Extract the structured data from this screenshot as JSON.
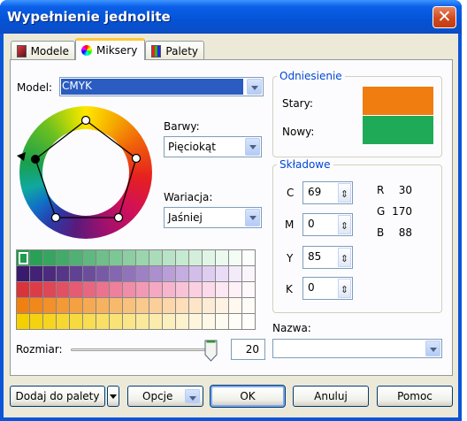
{
  "dialog": {
    "title": "Wypełnienie jednolite",
    "close_glyph": "✕"
  },
  "tabs": [
    {
      "label": "Modele",
      "icon": "models-icon"
    },
    {
      "label": "Miksery",
      "icon": "mixers-icon"
    },
    {
      "label": "Palety",
      "icon": "palettes-icon"
    }
  ],
  "model": {
    "label": "Model:",
    "value": "CMYK"
  },
  "harmony": {
    "label": "Barwy:",
    "value": "Pięciokąt"
  },
  "variation": {
    "label": "Wariacja:",
    "value": "Jaśniej"
  },
  "reference": {
    "title": "Odniesienie",
    "old_label": "Stary:",
    "new_label": "Nowy:",
    "old_color": "#f07d0f",
    "new_color": "#1faa58"
  },
  "components": {
    "title": "Składowe",
    "cmyk": [
      {
        "label": "C",
        "value": "69"
      },
      {
        "label": "M",
        "value": "0"
      },
      {
        "label": "Y",
        "value": "85"
      },
      {
        "label": "K",
        "value": "0"
      }
    ],
    "rgb": [
      {
        "label": "R",
        "value": "30"
      },
      {
        "label": "G",
        "value": "170"
      },
      {
        "label": "B",
        "value": "88"
      }
    ]
  },
  "name": {
    "label": "Nazwa:",
    "value": ""
  },
  "size": {
    "label": "Rozmiar:",
    "value": "20",
    "fraction": 1.0
  },
  "swatches": [
    [
      "#1f9c4d",
      "#2aa056",
      "#36a55f",
      "#43ab69",
      "#51b174",
      "#5fb87f",
      "#6ebf8a",
      "#7dc696",
      "#8ccea2",
      "#9bd5ae",
      "#aadcba",
      "#b8e3c6",
      "#c6e9d1",
      "#d3efdc",
      "#e0f5e6",
      "#ebf9ef",
      "#f4fcf6",
      "#fbfefc"
    ],
    [
      "#3a1a6e",
      "#432276",
      "#4c2b7f",
      "#563688",
      "#614192",
      "#6c4d9c",
      "#7859a6",
      "#8466b1",
      "#9173bb",
      "#9e81c5",
      "#ab8fcf",
      "#b99ed8",
      "#c6ade1",
      "#d3bde9",
      "#dfcdf0",
      "#eadcf6",
      "#f3eafa",
      "#faf5fd"
    ],
    [
      "#d9343a",
      "#dc3c48",
      "#df4656",
      "#e25064",
      "#e55b72",
      "#e86780",
      "#eb738e",
      "#ed809b",
      "#f08da8",
      "#f29ab5",
      "#f4a8c1",
      "#f6b5cc",
      "#f8c2d7",
      "#facfe1",
      "#fbdbea",
      "#fce7f2",
      "#fef1f8",
      "#fff9fc"
    ],
    [
      "#f08010",
      "#f1881c",
      "#f29029",
      "#f39936",
      "#f4a143",
      "#f5aa51",
      "#f6b25f",
      "#f7ba6d",
      "#f8c27c",
      "#f9ca8b",
      "#facf9a",
      "#fbd7a9",
      "#fcdeb8",
      "#fde5c7",
      "#fdecd5",
      "#fef2e2",
      "#fff8ef",
      "#fffcf8"
    ],
    [
      "#f4d000",
      "#f5d210",
      "#f6d520",
      "#f7d830",
      "#f7da40",
      "#f8dd52",
      "#f9e064",
      "#f9e376",
      "#fae689",
      "#fbe99b",
      "#fbecad",
      "#fcefbe",
      "#fdf2ce",
      "#fdf5dc",
      "#fef8e8",
      "#fefbf1",
      "#fffdf7",
      "#fffefb"
    ]
  ],
  "buttons": {
    "add_to_palette": "Dodaj do palety",
    "options": "Opcje",
    "ok": "OK",
    "cancel": "Anuluj",
    "help": "Pomoc"
  }
}
